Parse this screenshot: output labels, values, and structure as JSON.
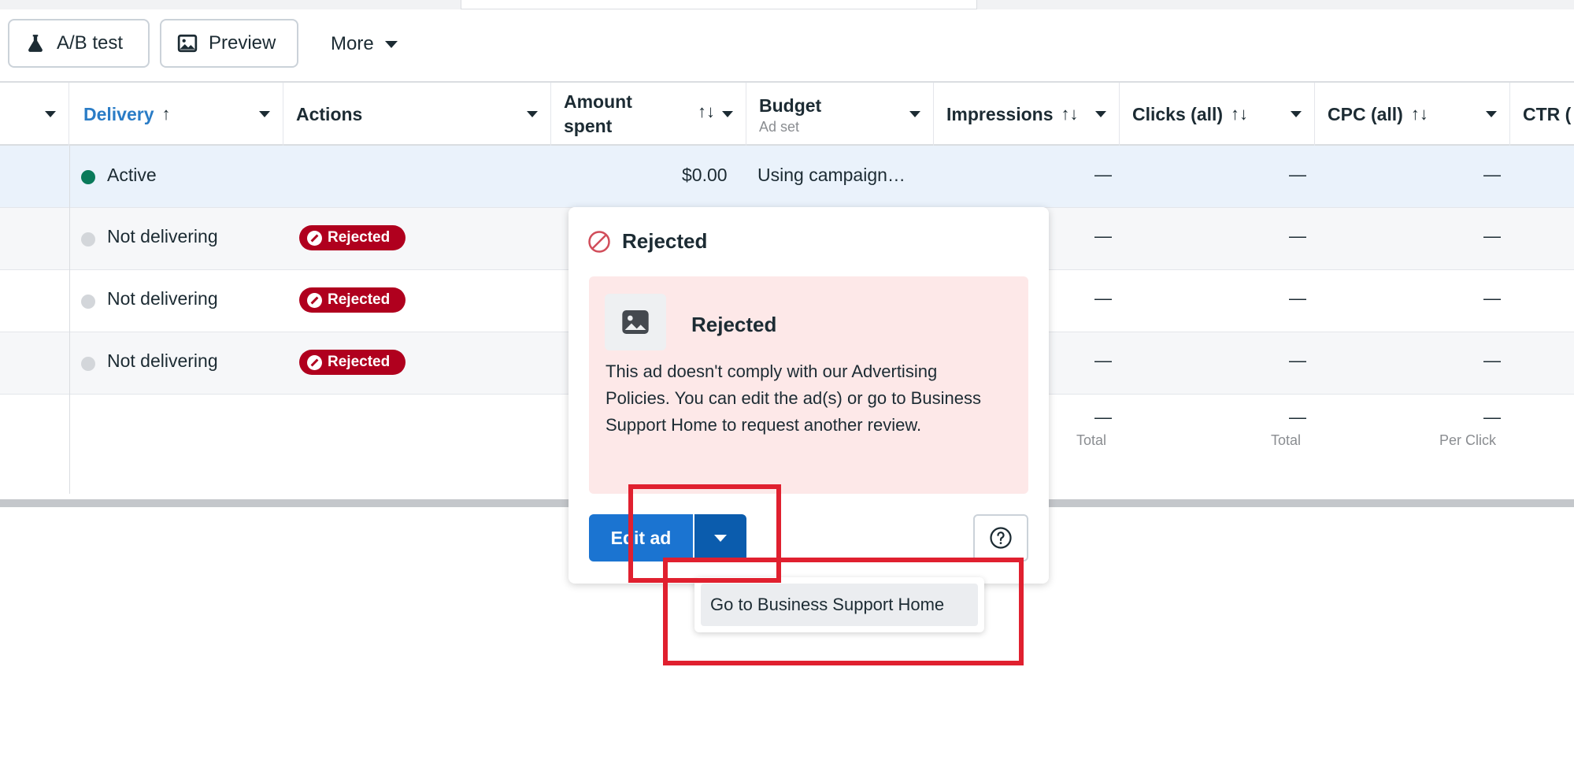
{
  "toolbar": {
    "ab_test": "A/B test",
    "preview": "Preview",
    "more": "More"
  },
  "columns": {
    "delivery": "Delivery",
    "delivery_sort": "↑",
    "actions": "Actions",
    "amount_spent_line1": "Amount",
    "amount_spent_line2": "spent",
    "budget": "Budget",
    "budget_sub": "Ad set",
    "impressions": "Impressions",
    "clicks": "Clicks (all)",
    "cpc": "CPC (all)",
    "ctr": "CTR (",
    "sort_icon": "↑↓"
  },
  "rows": [
    {
      "delivery": "Active",
      "status_color": "#0a7a5a",
      "amount": "$0.00",
      "budget": "Using campaign…",
      "impressions": "—",
      "clicks": "—",
      "cpc": "—"
    },
    {
      "delivery": "Not delivering",
      "status_color": "#d3d6da",
      "action": "Rejected",
      "impressions": "—",
      "clicks": "—",
      "cpc": "—"
    },
    {
      "delivery": "Not delivering",
      "status_color": "#d3d6da",
      "action": "Rejected",
      "impressions": "—",
      "clicks": "—",
      "cpc": "—"
    },
    {
      "delivery": "Not delivering",
      "status_color": "#d3d6da",
      "action": "Rejected",
      "impressions": "—",
      "clicks": "—",
      "cpc": "—"
    }
  ],
  "footer": {
    "impressions": "—",
    "impressions_label": "Total",
    "clicks": "—",
    "clicks_label": "Total",
    "cpc": "—",
    "cpc_label": "Per Click"
  },
  "popover": {
    "title": "Rejected",
    "card_title": "Rejected",
    "card_body": "This ad doesn't comply with our Advertising Policies. You can edit the ad(s) or go to Business Support Home to request another review.",
    "edit_button": "Edit ad",
    "dropdown_item": "Go to Business Support Home"
  },
  "colors": {
    "rejected_pill": "#b0001e",
    "primary_button": "#1b74d1",
    "highlight": "#e0202f",
    "card_background": "#fde8e8"
  }
}
